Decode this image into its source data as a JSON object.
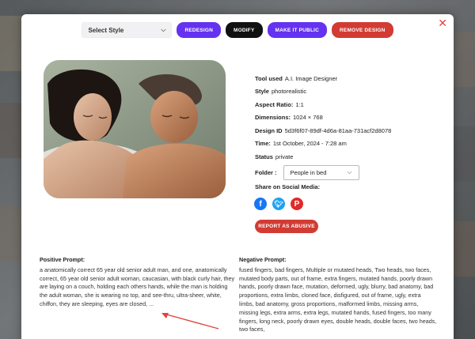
{
  "toolbar": {
    "style_select": "Select Style",
    "redesign": "REDESIGN",
    "modify": "MODIFY",
    "make_public": "MAKE IT PUBLIC",
    "remove_design": "REMOVE DESIGN"
  },
  "info": {
    "tool_label": "Tool used",
    "tool_value": "A.I. Image Designer",
    "style_label": "Style",
    "style_value": "photorealistic",
    "aspect_label": "Aspect Ratio:",
    "aspect_value": "1:1",
    "dims_label": "Dimensions:",
    "dims_value": "1024 × 768",
    "design_label": "Design ID",
    "design_value": "5d3f6f07-89df-4d6a-81aa-731acf2d8078",
    "time_label": "Time:",
    "time_value": "1st October, 2024 - 7:28 am",
    "status_label": "Status",
    "status_value": "private",
    "folder_label": "Folder :",
    "folder_value": "People in bed"
  },
  "share": {
    "title": "Share on Social Media:",
    "icons": [
      "facebook-icon",
      "twitter-icon",
      "pinterest-icon"
    ]
  },
  "report_button": "REPORT AS ABUSIVE",
  "positive": {
    "title": "Positive Prompt:",
    "text": "a anatomically correct 65 year old senior adult man, and one, anatomically correct, 65 year old senior adult woman, caucasian, with black curly hair, they are laying on a couch, holding each others hands, while the man is holding the adult woman, she is wearing no top, and see-thru, ultra-sheer, white, chiffon, they are sleeping, eyes are closed, ..."
  },
  "negative": {
    "title": "Negative Prompt:",
    "text": "fused fingers, bad fingers, Multiple or mutated heads, Two heads, two faces, mutated body parts, out of frame, extra fingers, mutated hands, poorly drawn hands, poorly drawn face, mutation, deformed, ugly, blurry, bad anatomy, bad proportions, extra limbs, cloned face, disfigured, out of frame, ugly, extra limbs, bad anatomy, gross proportions, malformed limbs, missing arms, missing legs, extra arms, extra legs, mutated hands, fused fingers, too many fingers, long neck, poorly drawn eyes, double heads, double faces, two heads, two faces,"
  },
  "colors": {
    "purple": "#6432f0",
    "red": "#d23b33",
    "close": "#e0453e"
  }
}
